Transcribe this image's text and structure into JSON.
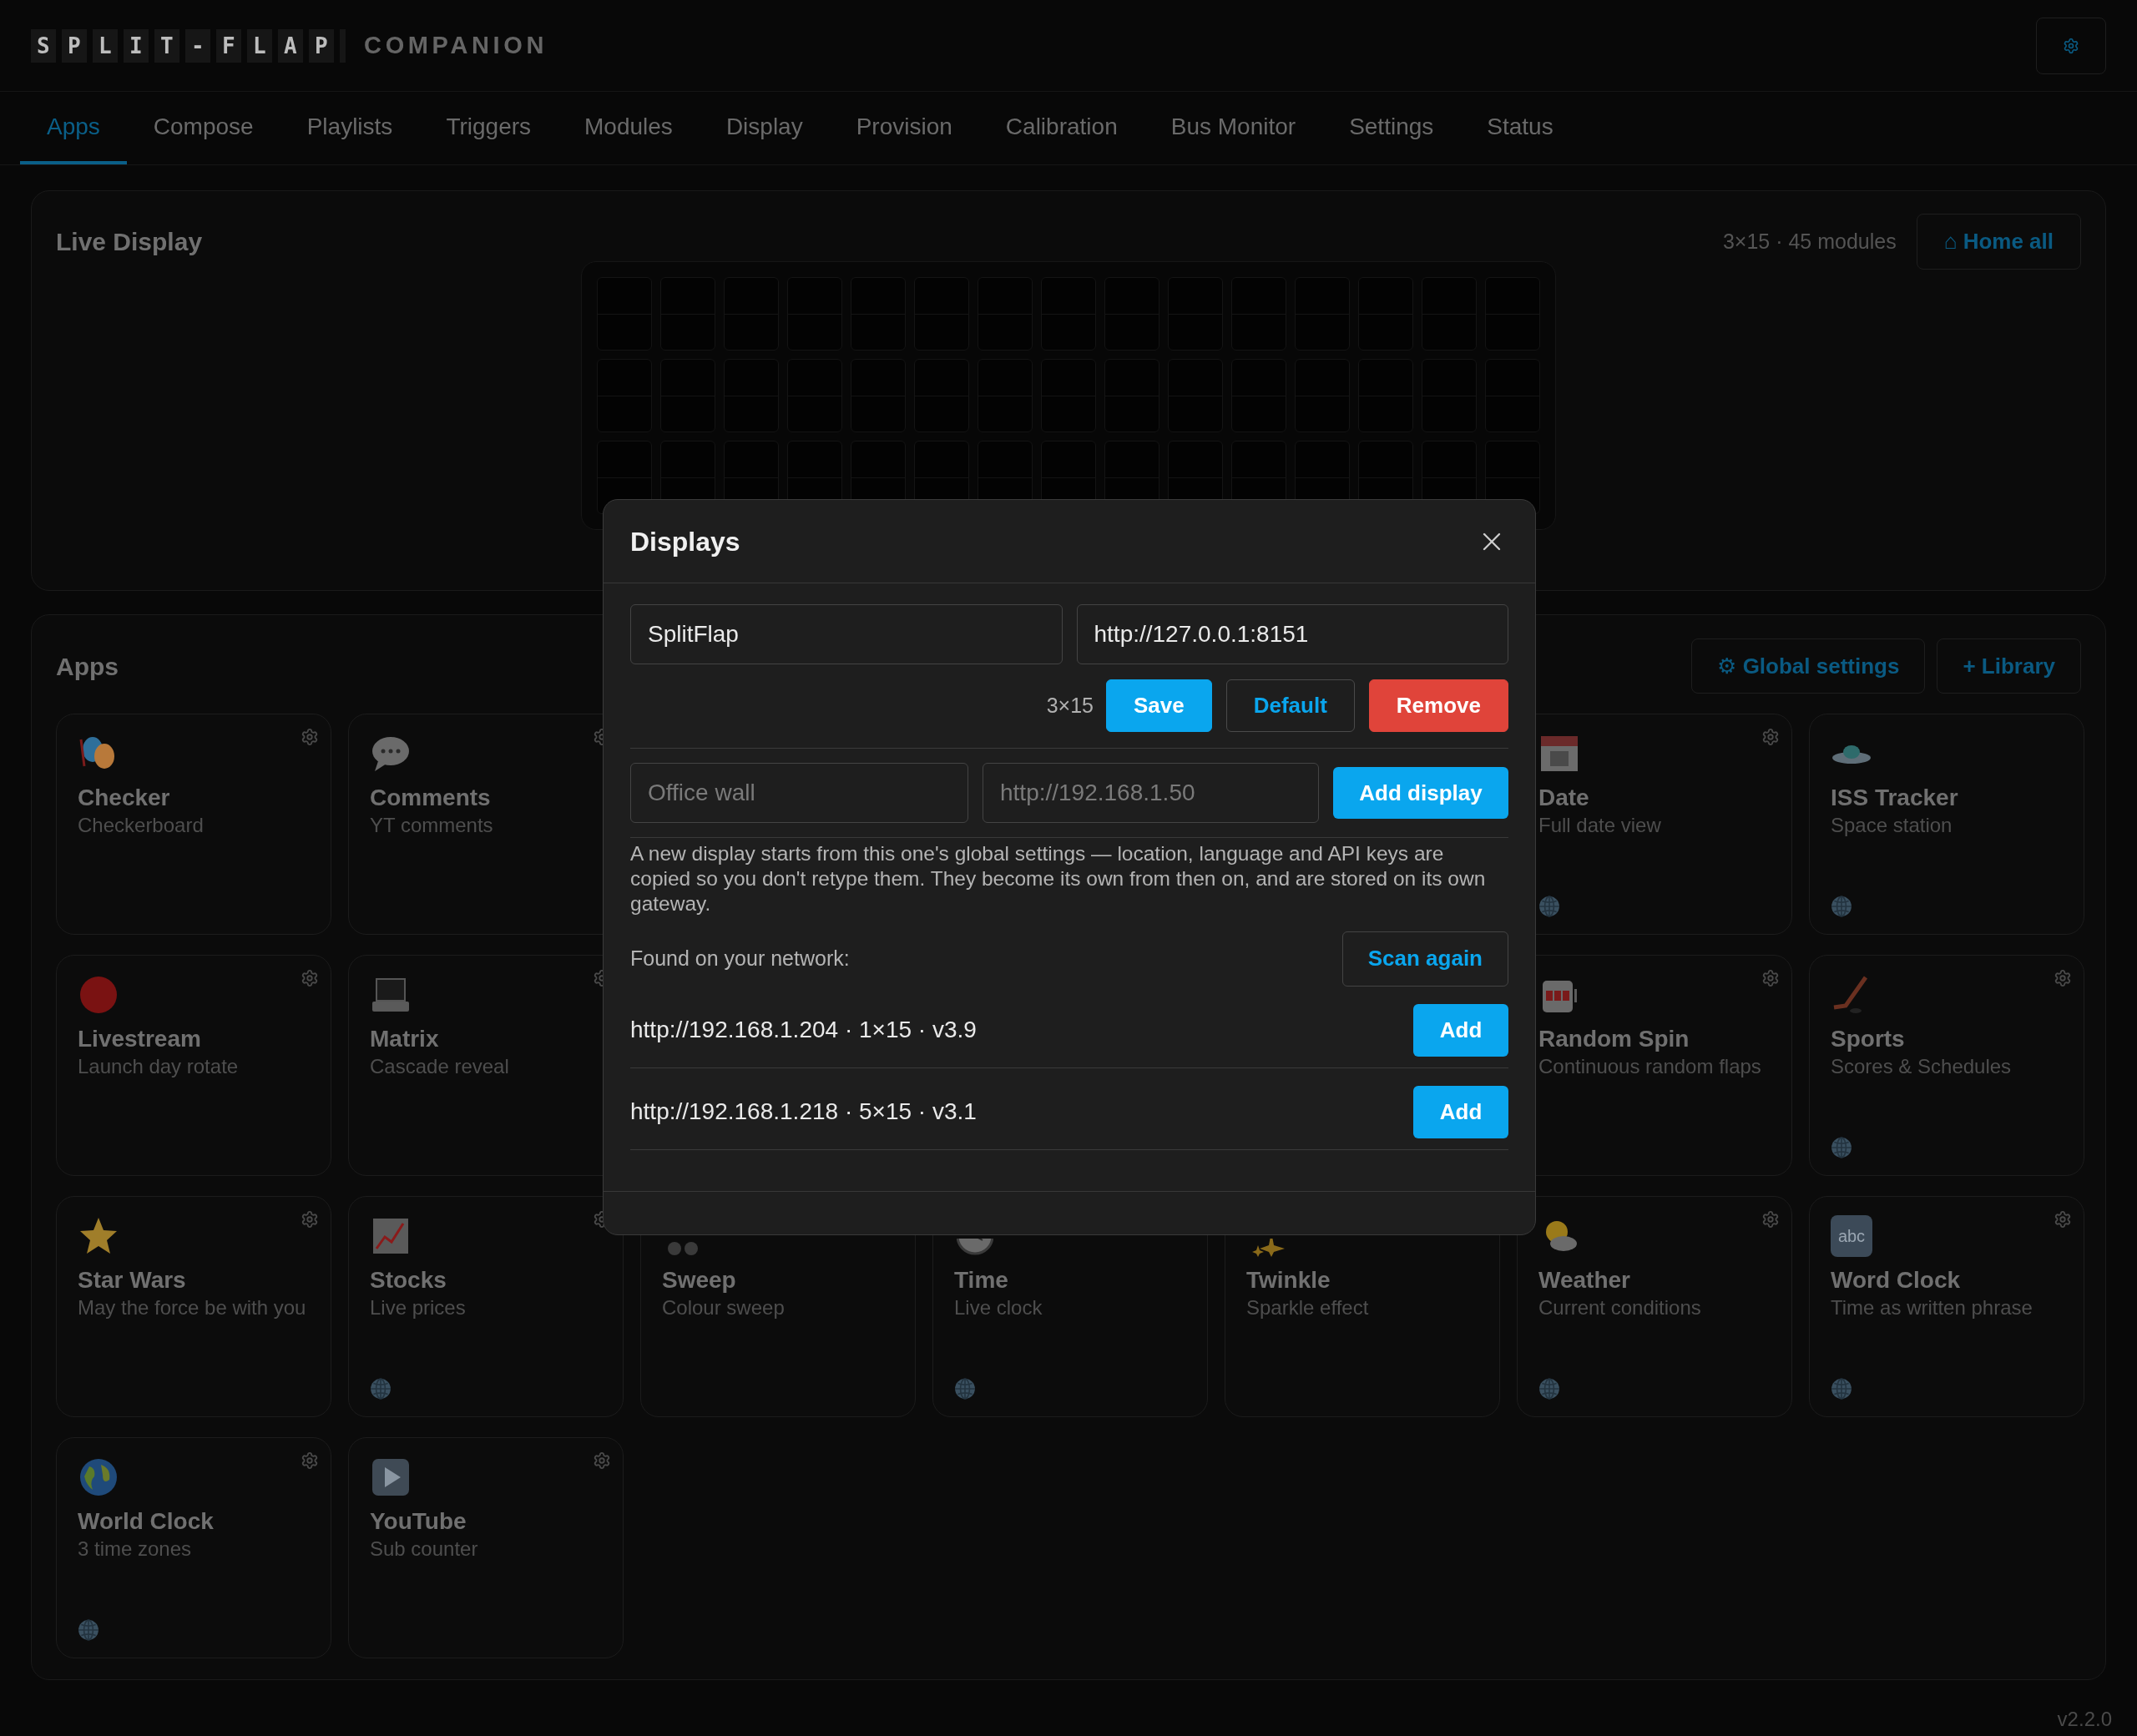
{
  "header": {
    "logo_tiles": "SPLIT-FLAP",
    "logo_text": "COMPANION"
  },
  "tabs": [
    {
      "label": "Apps",
      "selected": true
    },
    {
      "label": "Compose",
      "selected": false
    },
    {
      "label": "Playlists",
      "selected": false
    },
    {
      "label": "Triggers",
      "selected": false
    },
    {
      "label": "Modules",
      "selected": false
    },
    {
      "label": "Display",
      "selected": false
    },
    {
      "label": "Provision",
      "selected": false
    },
    {
      "label": "Calibration",
      "selected": false
    },
    {
      "label": "Bus Monitor",
      "selected": false
    },
    {
      "label": "Settings",
      "selected": false
    },
    {
      "label": "Status",
      "selected": false
    }
  ],
  "live_display": {
    "title": "Live Display",
    "summary": "3×15 · 45 modules",
    "home_button": "⌂ Home all"
  },
  "apps": {
    "title": "Apps",
    "buttons": [
      "⚙ Global settings",
      "+ Library"
    ],
    "cards": [
      {
        "title": "Checker",
        "subtitle": "Checkerboard",
        "configurable": true,
        "web": false
      },
      {
        "title": "Comments",
        "subtitle": "YT comments",
        "configurable": true,
        "web": false
      },
      {
        "title": "Date",
        "subtitle": "Full date view",
        "configurable": true,
        "web": true
      },
      {
        "title": "ISS Tracker",
        "subtitle": "Space station",
        "configurable": false,
        "web": true
      },
      {
        "title": "Livestream",
        "subtitle": "Launch day rotate",
        "configurable": true,
        "web": false
      },
      {
        "title": "Matrix",
        "subtitle": "Cascade reveal",
        "configurable": true,
        "web": false
      },
      {
        "title": "Random Spin",
        "subtitle": "Continuous random flaps",
        "configurable": true,
        "web": false
      },
      {
        "title": "Sports",
        "subtitle": "Scores & Schedules",
        "configurable": true,
        "web": true
      },
      {
        "title": "Star Wars",
        "subtitle": "May the force be with you",
        "configurable": true,
        "web": false
      },
      {
        "title": "Stocks",
        "subtitle": "Live prices",
        "configurable": true,
        "web": true
      },
      {
        "title": "Sweep",
        "subtitle": "Colour sweep",
        "configurable": false,
        "web": false
      },
      {
        "title": "Time",
        "subtitle": "Live clock",
        "configurable": false,
        "web": true
      },
      {
        "title": "Twinkle",
        "subtitle": "Sparkle effect",
        "configurable": false,
        "web": false
      },
      {
        "title": "Weather",
        "subtitle": "Current conditions",
        "configurable": true,
        "web": true
      },
      {
        "title": "Word Clock",
        "subtitle": "Time as written phrase",
        "configurable": true,
        "web": true,
        "icon_text": "abc"
      },
      {
        "title": "World Clock",
        "subtitle": "3 time zones",
        "configurable": true,
        "web": true
      },
      {
        "title": "YouTube",
        "subtitle": "Sub counter",
        "configurable": true,
        "web": false
      }
    ]
  },
  "modal": {
    "title": "Displays",
    "current": {
      "name": "SplitFlap",
      "url": "http://127.0.0.1:8151",
      "size": "3×15",
      "buttons": [
        {
          "label": "Save",
          "kind": "primary"
        },
        {
          "label": "Default",
          "kind": "outline"
        },
        {
          "label": "Remove",
          "kind": "danger"
        }
      ]
    },
    "new_display": {
      "name_placeholder": "Office wall",
      "url_placeholder": "http://192.168.1.50",
      "button": "Add display"
    },
    "note": "A new display starts from this one's global settings — location, language and API keys are copied so you don't retype them. They become its own from then on, and are stored on its own gateway.",
    "found_label": "Found on your network:",
    "scan_button": "Scan again",
    "found": [
      {
        "text": "http://192.168.1.204 · 1×15 · v3.9",
        "button": "Add"
      },
      {
        "text": "http://192.168.1.218 · 5×15 · v3.1",
        "button": "Add"
      }
    ]
  },
  "version": "v2.2.0"
}
